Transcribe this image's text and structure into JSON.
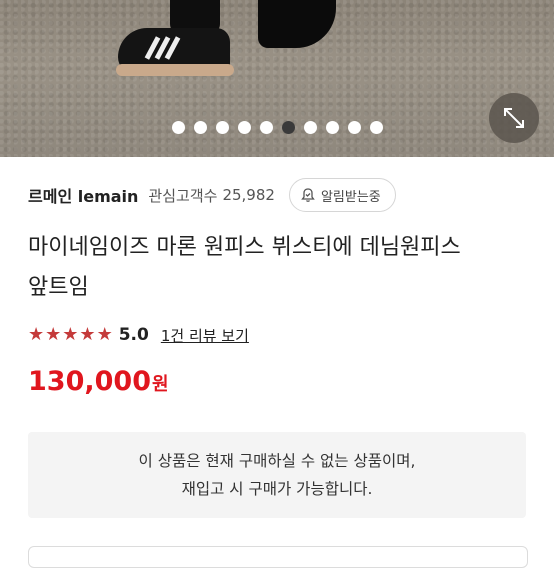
{
  "gallery": {
    "image_alt": "product photo",
    "dot_count": 10,
    "active_dot_index": 5
  },
  "seller": {
    "name": "르메인 lemain",
    "fans_label": "관심고객수",
    "fans_count": "25,982",
    "notify_label": "알림받는중"
  },
  "product": {
    "title_line1": "마이네임이즈 마론 원피스 뷔스티에 데님원피스",
    "title_line2": "앞트임",
    "rating": "5.0",
    "review_link": "1건 리뷰 보기",
    "price": "130,000",
    "price_unit": "원"
  },
  "notice": {
    "line1": "이 상품은 현재 구매하실 수 없는 상품이며,",
    "line2": "재입고 시 구매가 가능합니다."
  },
  "colors": {
    "accent_red": "#e0161e",
    "star_red": "#c43a3a"
  }
}
